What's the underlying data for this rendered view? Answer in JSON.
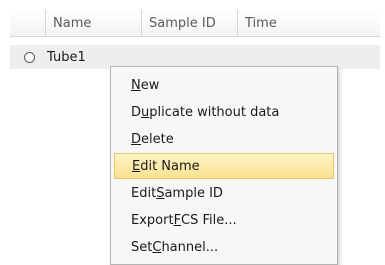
{
  "columns": {
    "name": "Name",
    "sample_id": "Sample ID",
    "time": "Time"
  },
  "rows": [
    {
      "label": "Tube1"
    }
  ],
  "context_menu": {
    "items": [
      {
        "pre": "",
        "key": "N",
        "post": "ew"
      },
      {
        "pre": "D",
        "key": "u",
        "post": "plicate without data"
      },
      {
        "pre": "",
        "key": "D",
        "post": "elete"
      },
      {
        "pre": "",
        "key": "E",
        "post": "dit Name",
        "highlighted": true
      },
      {
        "pre": "Edit ",
        "key": "S",
        "post": "ample ID"
      },
      {
        "pre": "Export ",
        "key": "F",
        "post": "CS File..."
      },
      {
        "pre": "Set ",
        "key": "C",
        "post": "hannel..."
      }
    ]
  }
}
